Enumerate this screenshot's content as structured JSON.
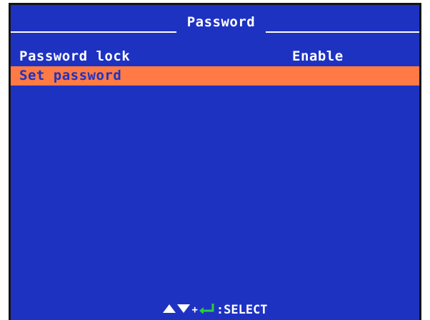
{
  "title": "Password",
  "menu": {
    "items": [
      {
        "label": "Password lock",
        "value": "Enable",
        "selected": false
      },
      {
        "label": "Set password",
        "value": "",
        "selected": true
      }
    ]
  },
  "footer": {
    "plus": "+",
    "hint": ":SELECT",
    "icons": [
      "up-arrow-icon",
      "down-arrow-icon",
      "enter-icon"
    ]
  },
  "colors": {
    "background": "#1e32c2",
    "text": "#ffffff",
    "highlight": "#ff7a45",
    "highlight_text": "#1e32c2",
    "enter_icon": "#2ecc40"
  }
}
